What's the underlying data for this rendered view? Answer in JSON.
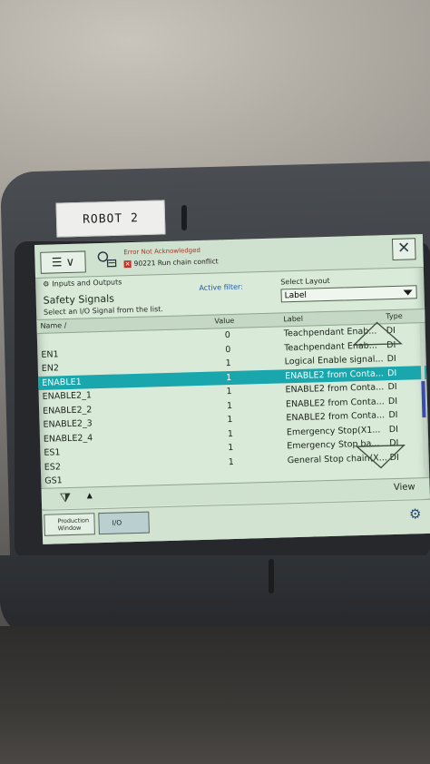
{
  "device": {
    "label": "ROBOT 2"
  },
  "topbar": {
    "menu_glyph": "☰ ∨",
    "error_title": "Error Not Acknowledged",
    "error_message": "90221 Run chain conflict",
    "close_glyph": "✕"
  },
  "breadcrumb": {
    "app": "Inputs and Outputs"
  },
  "page": {
    "title": "Safety Signals",
    "instruction": "Select an I/O Signal from the list.",
    "active_filter_label": "Active filter:",
    "select_layout_label": "Select Layout",
    "select_layout_value": "Label"
  },
  "table": {
    "headers": {
      "name": "Name ∕",
      "value": "Value",
      "label": "Label",
      "type": "Type"
    },
    "rows": [
      {
        "name": "",
        "value": "0",
        "label": "Teachpendant Enab...",
        "type": "DI"
      },
      {
        "name": "EN1",
        "value": "0",
        "label": "Teachpendant Enab...",
        "type": "DI"
      },
      {
        "name": "EN2",
        "value": "1",
        "label": "Logical Enable signal...",
        "type": "DI"
      },
      {
        "name": "ENABLE1",
        "value": "1",
        "label": "ENABLE2 from Conta...",
        "type": "DI",
        "selected": true
      },
      {
        "name": "ENABLE2_1",
        "value": "1",
        "label": "ENABLE2 from Conta...",
        "type": "DI"
      },
      {
        "name": "ENABLE2_2",
        "value": "1",
        "label": "ENABLE2 from Conta...",
        "type": "DI"
      },
      {
        "name": "ENABLE2_3",
        "value": "1",
        "label": "ENABLE2 from Conta...",
        "type": "DI"
      },
      {
        "name": "ENABLE2_4",
        "value": "1",
        "label": "Emergency Stop(X1...",
        "type": "DI"
      },
      {
        "name": "ES1",
        "value": "1",
        "label": "Emergency Stop ba...",
        "type": "DI"
      },
      {
        "name": "ES2",
        "value": "1",
        "label": "General Stop chain(X...",
        "type": "DI"
      },
      {
        "name": "GS1",
        "value": "",
        "label": "",
        "type": ""
      }
    ]
  },
  "bottombar": {
    "view_label": "View"
  },
  "taskbar": {
    "task1_label_line1": "Production",
    "task1_label_line2": "Window",
    "task2_label": "I/O"
  },
  "colors": {
    "selection": "#19a6ad",
    "screen_bg": "#d9ead9",
    "filter_label": "#1f5aa8",
    "error_red": "#c8312a"
  }
}
